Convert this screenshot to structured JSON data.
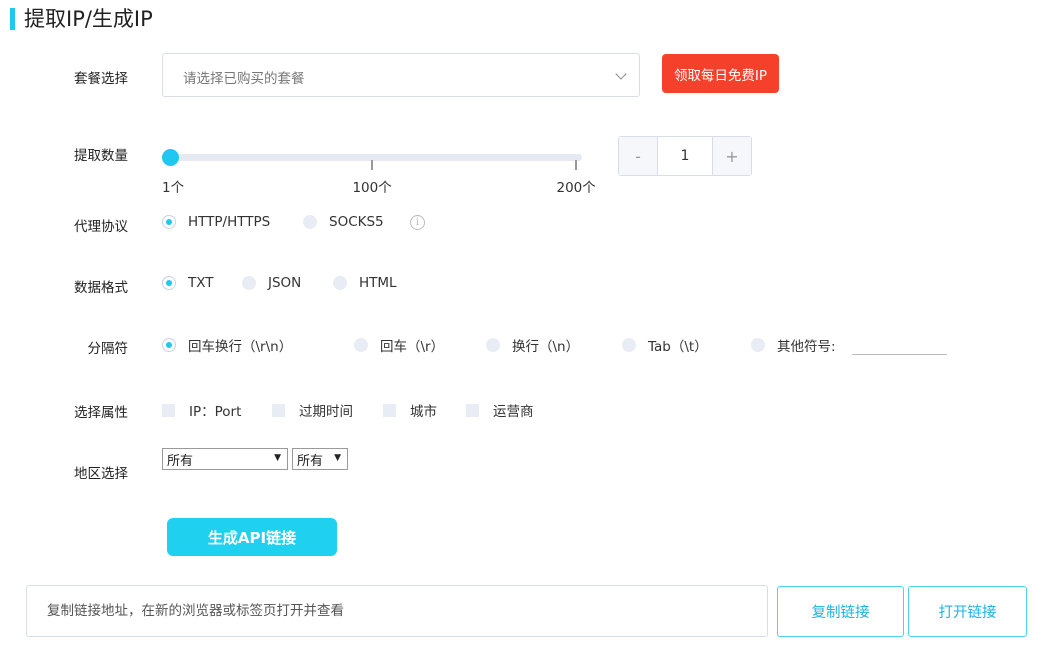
{
  "page": {
    "title": "提取IP/生成IP"
  },
  "package": {
    "label": "套餐选择",
    "placeholder": "请选择已购买的套餐",
    "free_button": "领取每日免费IP"
  },
  "quantity": {
    "label": "提取数量",
    "value": 1,
    "min": 1,
    "max": 200,
    "ticks": [
      {
        "value": 1,
        "label": "1个"
      },
      {
        "value": 100,
        "label": "100个"
      },
      {
        "value": 200,
        "label": "200个"
      }
    ],
    "stepper": {
      "minus": "-",
      "value": "1",
      "plus": "+"
    }
  },
  "protocol": {
    "label": "代理协议",
    "options": [
      "HTTP/HTTPS",
      "SOCKS5"
    ],
    "selected": 0,
    "info_icon": "info-circle-icon"
  },
  "format": {
    "label": "数据格式",
    "options": [
      "TXT",
      "JSON",
      "HTML"
    ],
    "selected": 0
  },
  "separator": {
    "label": "分隔符",
    "options": [
      "回车换行（\\r\\n）",
      "回车（\\r）",
      "换行（\\n）",
      "Tab（\\t）",
      "其他符号:"
    ],
    "selected": 0
  },
  "attributes": {
    "label": "选择属性",
    "options": [
      "IP：Port",
      "过期时间",
      "城市",
      "运营商"
    ]
  },
  "region": {
    "label": "地区选择",
    "province": "所有",
    "city": "所有"
  },
  "generate_button": "生成API链接",
  "link": {
    "placeholder": "复制链接地址，在新的浏览器或标签页打开并查看",
    "copy_button": "复制链接",
    "open_button": "打开链接"
  },
  "colors": {
    "accent": "#1fc8f0",
    "free_button": "#f5402c",
    "generate_button": "#1fd0ef"
  }
}
